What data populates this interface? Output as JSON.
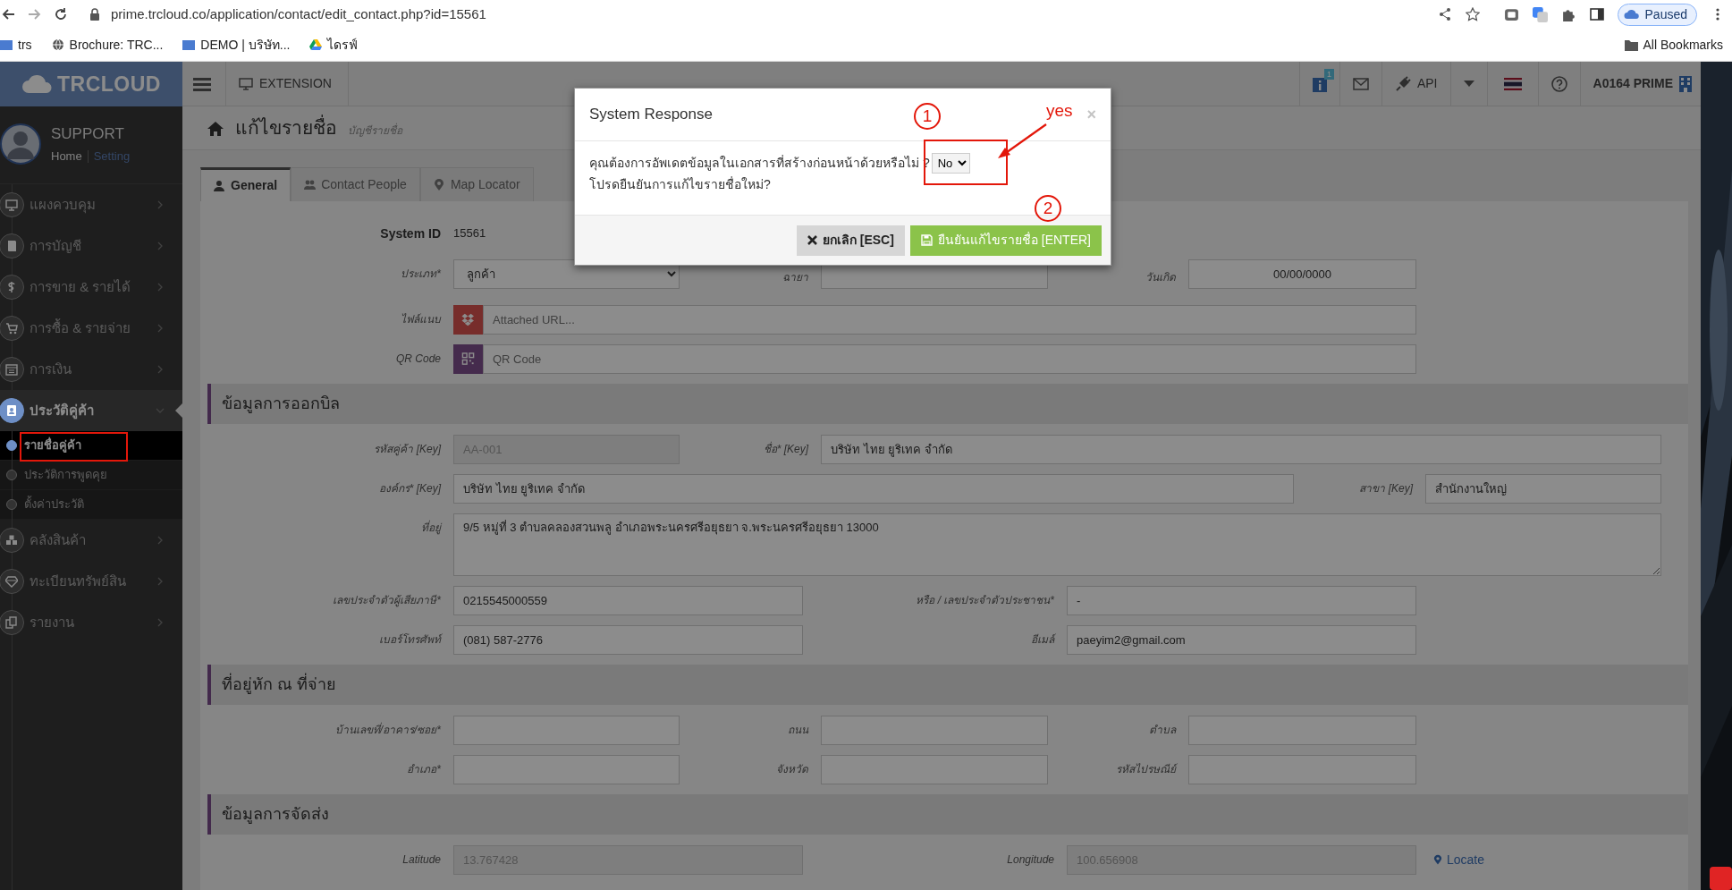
{
  "browser": {
    "url": "prime.trcloud.co/application/contact/edit_contact.php?id=15561",
    "profile_status": "Paused",
    "bookmarks": [
      {
        "label": "trs"
      },
      {
        "label": "Brochure: TRC..."
      },
      {
        "label": "DEMO | บริษัท..."
      },
      {
        "label": "ไดรฟ์"
      }
    ],
    "all_bookmarks": "All Bookmarks"
  },
  "header": {
    "logo": "TRCLOUD",
    "extension": "EXTENSION",
    "notification_badge": "1",
    "api": "API",
    "company": "A0164 PRIME"
  },
  "sidebar": {
    "user": "SUPPORT",
    "links": [
      "Home",
      "Setting"
    ],
    "items": [
      {
        "label": "แผงควบคุม",
        "selected": false,
        "expanded": false
      },
      {
        "label": "การบัญชี",
        "selected": false,
        "expanded": false
      },
      {
        "label": "การขาย & รายได้",
        "selected": false,
        "expanded": false
      },
      {
        "label": "การซื้อ & รายจ่าย",
        "selected": false,
        "expanded": false
      },
      {
        "label": "การเงิน",
        "selected": false,
        "expanded": false
      },
      {
        "label": "ประวัติคู่ค้า",
        "selected": true,
        "expanded": true,
        "children": [
          {
            "label": "รายชื่อคู่ค้า",
            "selected": true
          },
          {
            "label": "ประวัติการพูดคุย",
            "selected": false
          },
          {
            "label": "ตั้งค่าประวัติ",
            "selected": false
          }
        ]
      },
      {
        "label": "คลังสินค้า",
        "selected": false,
        "expanded": false
      },
      {
        "label": "ทะเบียนทรัพย์สิน",
        "selected": false,
        "expanded": false
      },
      {
        "label": "รายงาน",
        "selected": false,
        "expanded": false
      }
    ]
  },
  "page": {
    "title": "แก้ไขรายชื่อ",
    "subtitle": "บัญชีรายชื่อ"
  },
  "tabs": [
    {
      "label": "General",
      "selected": true
    },
    {
      "label": "Contact People",
      "selected": false
    },
    {
      "label": "Map Locator",
      "selected": false
    }
  ],
  "form": {
    "system_id": {
      "label": "System ID",
      "value": "15561"
    },
    "sections": [
      {
        "rows": [
          {
            "fields": [
              {
                "label": "ประเภท*",
                "kind": "select",
                "value": "ลูกค้า"
              },
              {
                "label": "ฉายา",
                "kind": "text",
                "disabled": false
              },
              {
                "label": "วันเกิด",
                "kind": "text",
                "value": "00/00/0000",
                "disabled": false
              }
            ]
          },
          {
            "fields": [
              {
                "label": "ไฟล์แนบ",
                "kind": "addon",
                "placeholder": "Attached URL...",
                "disabled": false
              }
            ]
          },
          {
            "fields": [
              {
                "label": "QR Code",
                "kind": "addon",
                "placeholder": "QR Code",
                "disabled": false
              }
            ]
          }
        ]
      },
      {
        "title": "ข้อมูลการออกบิล",
        "rows": [
          {
            "fields": [
              {
                "label": "รหัสคู่ค้า [Key]",
                "kind": "text",
                "value": "AA-001",
                "disabled": true
              },
              {
                "label": "ชื่อ* [Key]",
                "kind": "text",
                "value": "บริษัท ไทย ยูริเทค จำกัด",
                "disabled": false
              }
            ]
          },
          {
            "fields": [
              {
                "label": "องค์กร* [Key]",
                "kind": "text",
                "value": "บริษัท ไทย ยูริเทค จำกัด",
                "disabled": false
              },
              {
                "label": "สาขา [Key]",
                "kind": "text",
                "value": "สำนักงานใหญ่",
                "disabled": false
              }
            ]
          },
          {
            "fields": [
              {
                "label": "ที่อยู่",
                "kind": "textarea",
                "value": "9/5 หมู่ที่ 3 ตำบลคลองสวนพลู อำเภอพระนครศรีอยุธยา จ.พระนครศรีอยุธยา 13000",
                "disabled": false
              }
            ]
          },
          {
            "fields": [
              {
                "label": "เลขประจำตัวผู้เสียภาษี*",
                "kind": "text",
                "value": "0215545000559",
                "disabled": false
              },
              {
                "label": "หรือ / เลขประจำตัวประชาชน*",
                "kind": "text",
                "value": "-",
                "disabled": false
              }
            ]
          },
          {
            "fields": [
              {
                "label": "เบอร์โทรศัพท์",
                "kind": "text",
                "value": "(081) 587-2776",
                "disabled": false
              },
              {
                "label": "อีเมล์",
                "kind": "text",
                "value": "paeyim2@gmail.com",
                "disabled": false
              }
            ]
          }
        ]
      },
      {
        "title": "ที่อยู่หัก ณ ที่จ่าย",
        "rows": [
          {
            "fields": [
              {
                "label": "บ้านเลขที่/อาคาร/ซอย*",
                "kind": "text",
                "disabled": false
              },
              {
                "label": "ถนน",
                "kind": "text",
                "disabled": false
              },
              {
                "label": "ตำบล",
                "kind": "text",
                "disabled": false
              }
            ]
          },
          {
            "fields": [
              {
                "label": "อำเภอ*",
                "kind": "text",
                "disabled": false
              },
              {
                "label": "จังหวัด",
                "kind": "text",
                "disabled": false
              },
              {
                "label": "รหัสไปรษณีย์",
                "kind": "text",
                "disabled": false
              }
            ]
          }
        ]
      },
      {
        "title": "ข้อมูลการจัดส่ง",
        "rows": [
          {
            "fields": [
              {
                "label": "Latitude",
                "kind": "text",
                "value": "13.767428",
                "disabled": true
              },
              {
                "label": "Longitude",
                "kind": "text",
                "value": "100.656908",
                "disabled": true
              },
              {
                "kind": "link",
                "text": "Locate"
              }
            ]
          }
        ]
      }
    ]
  },
  "modal": {
    "title": "System Response",
    "close": "×",
    "question": "คุณต้องการอัพเดตข้อมูลในเอกสารที่สร้างก่อนหน้าด้วยหรือไม่ ?",
    "answer": "No",
    "confirm_text": "โปรดยืนยันการแก้ไขรายชื่อใหม่?",
    "buttons": [
      {
        "label": "ยกเลิก [ESC]",
        "kind": "cancel"
      },
      {
        "label": "ยืนยันแก้ไขรายชื่อ [ENTER]",
        "kind": "confirm"
      }
    ]
  },
  "annotations": [
    {
      "kind": "step",
      "text": "1"
    },
    {
      "kind": "note",
      "text": "yes"
    },
    {
      "kind": "step",
      "text": "2"
    }
  ]
}
